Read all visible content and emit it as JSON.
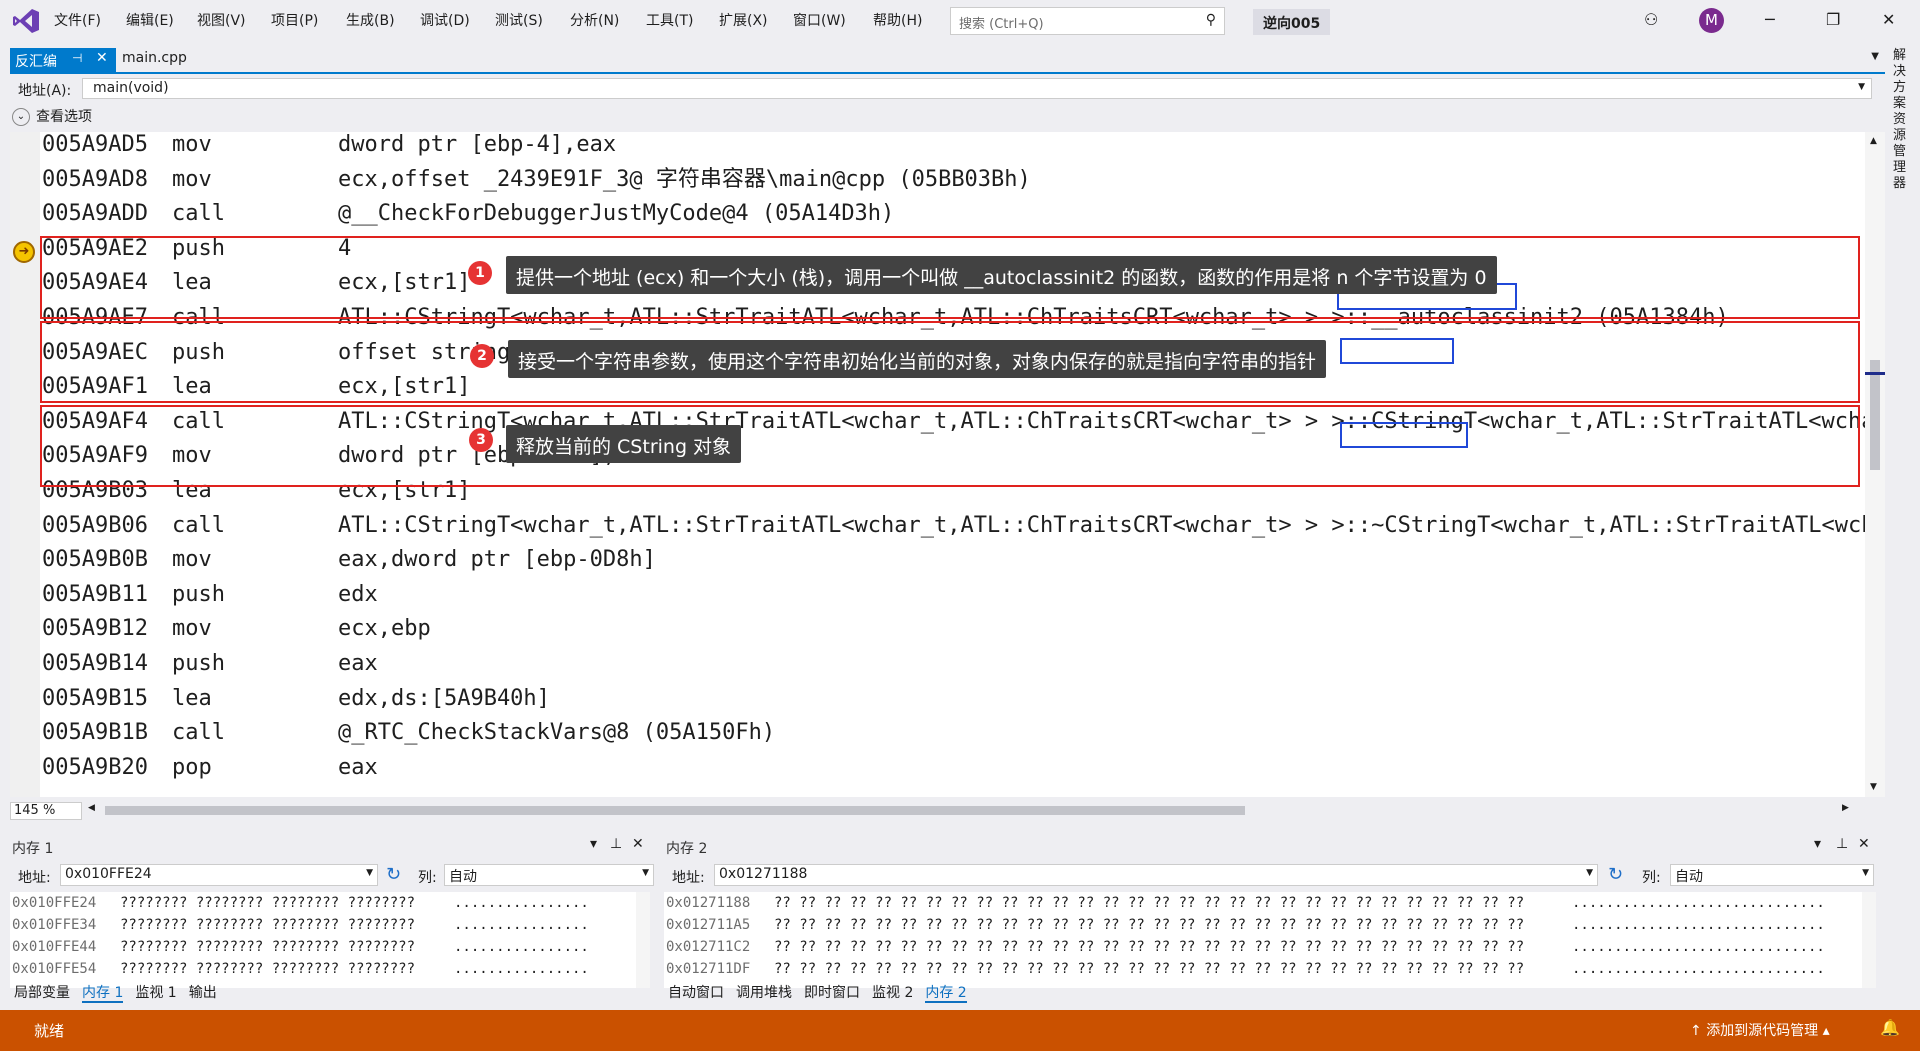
{
  "window": {
    "menus": [
      "文件(F)",
      "编辑(E)",
      "视图(V)",
      "项目(P)",
      "生成(B)",
      "调试(D)",
      "测试(S)",
      "分析(N)",
      "工具(T)",
      "扩展(X)",
      "窗口(W)",
      "帮助(H)"
    ],
    "search_placeholder": "搜索 (Ctrl+Q)",
    "solution": "逆向005",
    "avatar": "M"
  },
  "tabs": {
    "disasm": "反汇编",
    "main": "main.cpp"
  },
  "address_label": "地址(A):",
  "address_value": "main(void)",
  "view_options": "查看选项",
  "lines": [
    {
      "addr": "005A9AD5",
      "mn": "mov",
      "op": "dword ptr [ebp-4],eax"
    },
    {
      "addr": "005A9AD8",
      "mn": "mov",
      "op": "ecx,offset _2439E91F_3@ 字符串容器\\main@cpp (05BB03Bh)"
    },
    {
      "addr": "005A9ADD",
      "mn": "call",
      "op": "@__CheckForDebuggerJustMyCode@4 (05A14D3h)"
    },
    {
      "addr": "005A9AE2",
      "mn": "push",
      "op": "4"
    },
    {
      "addr": "005A9AE4",
      "mn": "lea",
      "op": "ecx,[str1]"
    },
    {
      "addr": "005A9AE7",
      "mn": "call",
      "op": "ATL::CStringT<wchar_t,ATL::StrTraitATL<wchar_t,ATL::ChTraitsCRT<wchar_t> > >::__autoclassinit2 (05A1384h)"
    },
    {
      "addr": "005A9AEC",
      "mn": "push",
      "op": "offset string \"hello world\" (05B3CD8h)"
    },
    {
      "addr": "005A9AF1",
      "mn": "lea",
      "op": "ecx,[str1]"
    },
    {
      "addr": "005A9AF4",
      "mn": "call",
      "op": "ATL::CStringT<wchar_t,ATL::StrTraitATL<wchar_t,ATL::ChTraitsCRT<wchar_t> > >::CStringT<wchar_t,ATL::StrTraitATL<wchar_t"
    },
    {
      "addr": "005A9AF9",
      "mn": "mov",
      "op": "dword ptr [ebp-0D8h],0"
    },
    {
      "addr": "005A9B03",
      "mn": "lea",
      "op": "ecx,[str1]"
    },
    {
      "addr": "005A9B06",
      "mn": "call",
      "op": "ATL::CStringT<wchar_t,ATL::StrTraitATL<wchar_t,ATL::ChTraitsCRT<wchar_t> > >::~CStringT<wchar_t,ATL::StrTraitATL<wchar"
    },
    {
      "addr": "005A9B0B",
      "mn": "mov",
      "op": "eax,dword ptr [ebp-0D8h]"
    },
    {
      "addr": "005A9B11",
      "mn": "push",
      "op": "edx"
    },
    {
      "addr": "005A9B12",
      "mn": "mov",
      "op": "ecx,ebp"
    },
    {
      "addr": "005A9B14",
      "mn": "push",
      "op": "eax"
    },
    {
      "addr": "005A9B15",
      "mn": "lea",
      "op": "edx,ds:[5A9B40h]"
    },
    {
      "addr": "005A9B1B",
      "mn": "call",
      "op": "@_RTC_CheckStackVars@8 (05A150Fh)"
    },
    {
      "addr": "005A9B20",
      "mn": "pop",
      "op": "eax"
    }
  ],
  "notes": [
    {
      "num": "1",
      "text": "提供一个地址 (ecx) 和一个大小 (栈)，调用一个叫做 __autoclassinit2 的函数，函数的作用是将 n 个字节设置为 0"
    },
    {
      "num": "2",
      "text": "接受一个字符串参数，使用这个字符串初始化当前的对象，对象内保存的就是指向字符串的指针"
    },
    {
      "num": "3",
      "text": "释放当前的 CString 对象"
    }
  ],
  "zoom": "145 %",
  "mem1": {
    "title": "内存 1",
    "addr_label": "地址:",
    "addr": "0x010FFE24",
    "col_label": "列:",
    "col": "自动",
    "rows": [
      {
        "a": "0x010FFE24",
        "h": "???????? ???????? ???????? ????????",
        "t": "................"
      },
      {
        "a": "0x010FFE34",
        "h": "???????? ???????? ???????? ????????",
        "t": "................"
      },
      {
        "a": "0x010FFE44",
        "h": "???????? ???????? ???????? ????????",
        "t": "................"
      },
      {
        "a": "0x010FFE54",
        "h": "???????? ???????? ???????? ????????",
        "t": "................"
      }
    ],
    "tabs": [
      "局部变量",
      "内存 1",
      "监视 1",
      "输出"
    ]
  },
  "mem2": {
    "title": "内存 2",
    "addr_label": "地址:",
    "addr": "0x01271188",
    "col_label": "列:",
    "col": "自动",
    "rows": [
      {
        "a": "0x01271188",
        "h": "?? ?? ?? ?? ?? ?? ?? ?? ?? ?? ?? ?? ?? ?? ?? ?? ?? ?? ?? ?? ?? ?? ?? ?? ?? ?? ?? ?? ?? ??",
        "t": ".............................."
      },
      {
        "a": "0x012711A5",
        "h": "?? ?? ?? ?? ?? ?? ?? ?? ?? ?? ?? ?? ?? ?? ?? ?? ?? ?? ?? ?? ?? ?? ?? ?? ?? ?? ?? ?? ?? ??",
        "t": ".............................."
      },
      {
        "a": "0x012711C2",
        "h": "?? ?? ?? ?? ?? ?? ?? ?? ?? ?? ?? ?? ?? ?? ?? ?? ?? ?? ?? ?? ?? ?? ?? ?? ?? ?? ?? ?? ?? ??",
        "t": ".............................."
      },
      {
        "a": "0x012711DF",
        "h": "?? ?? ?? ?? ?? ?? ?? ?? ?? ?? ?? ?? ?? ?? ?? ?? ?? ?? ?? ?? ?? ?? ?? ?? ?? ?? ?? ?? ?? ??",
        "t": ".............................."
      }
    ],
    "tabs": [
      "自动窗口",
      "调用堆栈",
      "即时窗口",
      "监视 2",
      "内存 2"
    ]
  },
  "status": {
    "ready": "就绪",
    "source": "添加到源代码管理"
  },
  "right_dock": "解决方案资源管理器"
}
